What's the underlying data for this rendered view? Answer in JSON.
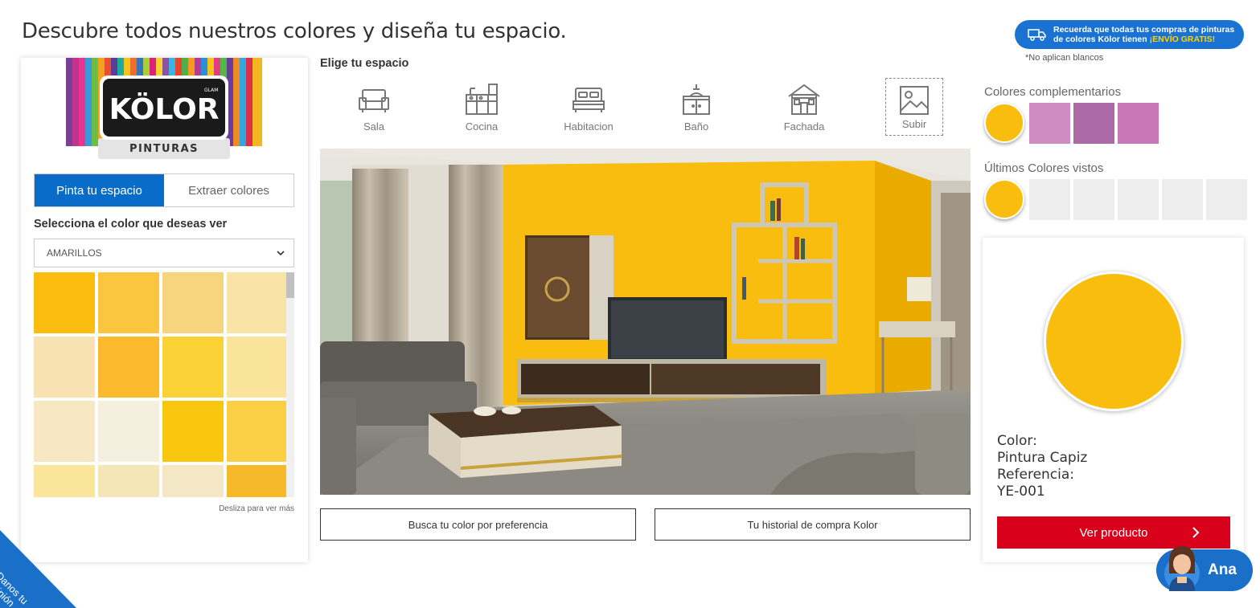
{
  "page": {
    "title": "Descubre todos nuestros colores y diseña tu espacio."
  },
  "shipping": {
    "line1": "Recuerda que todas tus compras de pinturas",
    "line2_prefix": "de colores Kölor tienen ",
    "line2_highlight": "¡ENVÍO GRATIS!",
    "note": "*No aplican blancos",
    "icon": "truck-icon"
  },
  "brand": {
    "logo_text": "KÖLOR",
    "logo_sub": "PINTURAS",
    "logo_small": "GLAM"
  },
  "left": {
    "tabs": [
      {
        "label": "Pinta tu espacio",
        "active": true
      },
      {
        "label": "Extraer colores",
        "active": false
      }
    ],
    "select_label": "Selecciona el color que deseas ver",
    "select_value": "AMARILLOS",
    "scroll_hint": "Desliza para ver más",
    "swatches": [
      "#fbbd0f",
      "#fcc540",
      "#f6d57e",
      "#f9e3a6",
      "#f8e2b3",
      "#fbb92d",
      "#fbd236",
      "#fae49b",
      "#f7e7c3",
      "#f5efdf",
      "#f9c60f",
      "#fbcf45",
      "#fae59a",
      "#f4e6b6",
      "#f4e7c5",
      "#f5b92b"
    ]
  },
  "middle": {
    "choose_label": "Elige tu espacio",
    "spaces": [
      {
        "label": "Sala",
        "icon": "sofa-icon"
      },
      {
        "label": "Cocina",
        "icon": "kitchen-icon"
      },
      {
        "label": "Habitacion",
        "icon": "bed-icon"
      },
      {
        "label": "Baño",
        "icon": "bathroom-sink-icon"
      },
      {
        "label": "Fachada",
        "icon": "house-facade-icon"
      },
      {
        "label": "Subir",
        "icon": "image-upload-icon"
      }
    ],
    "wall_color": "#f8bd0e",
    "buttons": {
      "search_pref": "Busca tu color por preferencia",
      "history": "Tu historial de compra Kolor"
    }
  },
  "right": {
    "complementary_title": "Colores complementarios",
    "complementary": [
      "#f9bd0e",
      "#cf8cc4",
      "#ab6aa6",
      "#c777b6"
    ],
    "recent_title": "Últimos Colores vistos",
    "recent": [
      "#f9bd0e",
      "#ededed",
      "#ededed",
      "#ededed",
      "#ededed",
      "#ededed"
    ],
    "detail": {
      "color_label": "Color:",
      "color_name": "Pintura Capiz",
      "ref_label": "Referencia:",
      "ref_value": "YE-001",
      "swatch": "#f9bd0e",
      "button": "Ver producto"
    }
  },
  "assistant": {
    "name": "Ana"
  },
  "feedback": {
    "line1": "Danos tu",
    "line2": "opinión"
  }
}
